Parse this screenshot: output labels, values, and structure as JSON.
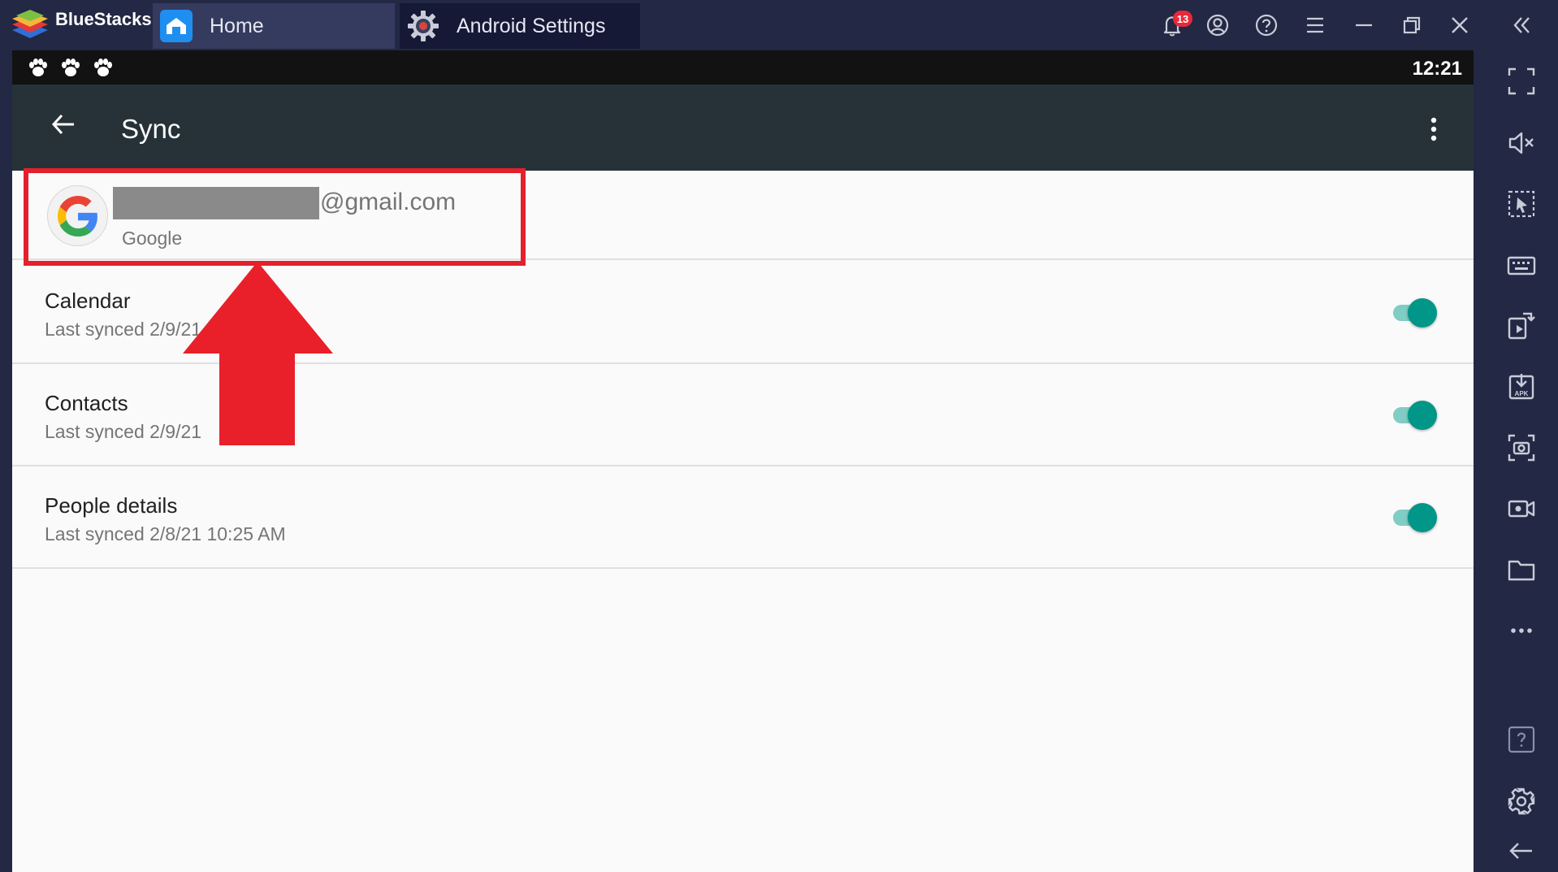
{
  "titlebar": {
    "app_name": "BlueStacks",
    "tabs": [
      {
        "label": "Home",
        "icon": "home-icon"
      },
      {
        "label": "Android Settings",
        "icon": "gear-icon"
      }
    ],
    "notification_count": "13",
    "buttons": [
      "bell-icon",
      "account-icon",
      "help-icon",
      "menu-icon",
      "minimize-icon",
      "restore-icon",
      "close-icon",
      "collapse-sidebar-icon"
    ]
  },
  "android": {
    "status_bar": {
      "time": "12:21",
      "icons": [
        "paw-icon",
        "paw-icon",
        "paw-icon"
      ]
    },
    "app_bar": {
      "title": "Sync"
    },
    "account": {
      "email_suffix": "@gmail.com",
      "provider": "Google"
    },
    "sync_items": [
      {
        "title": "Calendar",
        "subtitle": "Last synced 2/9/21",
        "enabled": true
      },
      {
        "title": "Contacts",
        "subtitle": "Last synced 2/9/21",
        "enabled": true
      },
      {
        "title": "People details",
        "subtitle": "Last synced 2/8/21 10:25 AM",
        "enabled": true
      }
    ]
  },
  "sidebar": {
    "buttons": [
      "fullscreen-icon",
      "volume-mute-icon",
      "pointer-icon",
      "keyboard-icon",
      "rotate-icon",
      "install-apk-icon",
      "screenshot-icon",
      "record-icon",
      "folder-icon",
      "more-icon",
      "help-icon",
      "settings-icon",
      "back-icon"
    ]
  },
  "colors": {
    "chrome_bg": "#232844",
    "app_bar": "#263238",
    "toggle_on": "#009688",
    "annotation_red": "#e3202b"
  }
}
